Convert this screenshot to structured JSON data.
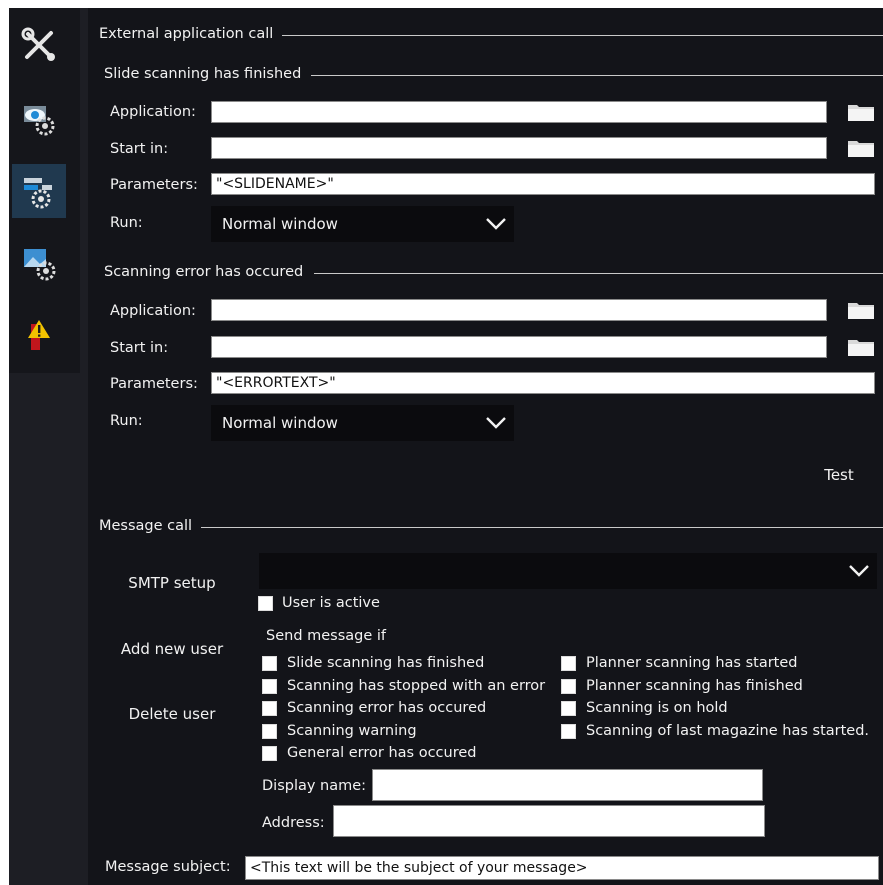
{
  "ext_section": {
    "title": "External application call",
    "finished": {
      "title": "Slide scanning has finished",
      "application_label": "Application:",
      "application_value": "",
      "start_in_label": "Start in:",
      "start_in_value": "",
      "parameters_label": "Parameters:",
      "parameters_value": "\"<SLIDENAME>\"",
      "run_label": "Run:",
      "run_value": "Normal window"
    },
    "error": {
      "title": "Scanning error has occured",
      "application_label": "Application:",
      "application_value": "",
      "start_in_label": "Start in:",
      "start_in_value": "",
      "parameters_label": "Parameters:",
      "parameters_value": "\"<ERRORTEXT>\"",
      "run_label": "Run:",
      "run_value": "Normal window"
    },
    "test_label": "Test"
  },
  "message": {
    "title": "Message call",
    "smtp_label": "SMTP setup",
    "smtp_value": "",
    "user_active_label": "User is active",
    "add_user_label": "Add new user",
    "delete_user_label": "Delete user",
    "send_if_label": "Send message if",
    "conditions_left": [
      "Slide scanning has finished",
      "Scanning has stopped with an error",
      "Scanning error has occured",
      "Scanning warning",
      "General error has occured"
    ],
    "conditions_right": [
      "Planner scanning has started",
      "Planner scanning has finished",
      "Scanning is on hold",
      "Scanning of last magazine has started."
    ],
    "display_name_label": "Display name:",
    "display_name_value": "",
    "address_label": "Address:",
    "address_value": "",
    "subject_label": "Message subject:",
    "subject_value": "<This text will be the subject of your message>"
  },
  "sidebar": {
    "items": [
      {
        "icon": "tools-icon"
      },
      {
        "icon": "eye-settings-icon"
      },
      {
        "icon": "application-settings-icon",
        "active": true
      },
      {
        "icon": "image-settings-icon"
      },
      {
        "icon": "warning-icon"
      }
    ]
  },
  "colors": {
    "background": "#131419",
    "sidebar": "#15161b",
    "active_tab": "#20394f",
    "input": "#ffffff",
    "dropdown": "#0b0b0e"
  }
}
